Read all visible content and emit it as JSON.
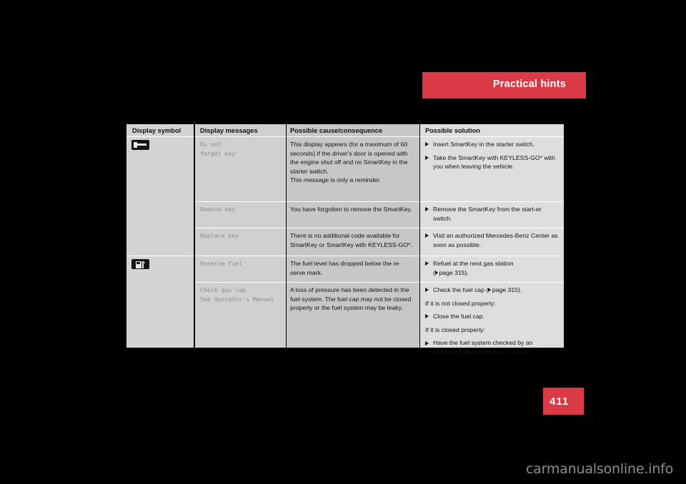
{
  "header": {
    "chapter_title": "Practical hints",
    "accent_color": "#d93a46"
  },
  "page_number": "411",
  "watermark": "carmanualsonline.info",
  "table": {
    "columns": [
      {
        "key": "symbol",
        "header": "Display symbol"
      },
      {
        "key": "messages",
        "header": "Display messages"
      },
      {
        "key": "cause",
        "header": "Possible cause/consequence"
      },
      {
        "key": "solution",
        "header": "Possible solution"
      }
    ],
    "rows": [
      {
        "symbol_icon": "key-in-display-icon",
        "message": "Do not\nforget key",
        "cause": "This display appears (for a maximum of 60 seconds) if the driver's door is opened with the engine shut off and no SmartKey in the starter switch.\nThis message is only a reminder.",
        "solution": [
          {
            "type": "bullet",
            "text": "Insert SmartKey in the starter switch."
          },
          {
            "type": "bullet",
            "text": "Take the SmartKey with KEYLESS-GO* with you when leaving the vehicle."
          }
        ]
      },
      {
        "symbol_icon": "",
        "message": "Remove key",
        "cause": "You have forgotten to remove the SmartKey.",
        "solution": [
          {
            "type": "bullet",
            "text": "Remove the SmartKey from the start-er switch."
          }
        ]
      },
      {
        "symbol_icon": "",
        "message": "Replace key",
        "cause": "There is no additional code available for SmartKey or SmartKey with KEYLESS-GO*.",
        "solution": [
          {
            "type": "bullet",
            "text": "Visit an authorized Mercedes-Benz Center as soon as possible."
          }
        ]
      },
      {
        "symbol_icon": "fuel-pump-icon",
        "message": "Reserve fuel",
        "cause": "The fuel level has dropped below the re-serve mark.",
        "solution": [
          {
            "type": "bullet",
            "text": "Refuel at the next gas station"
          },
          {
            "type": "pageref",
            "text": "page 315)."
          }
        ]
      },
      {
        "symbol_icon": "",
        "message": "Check gas cap\nSee Operator's Manual",
        "cause": "A loss of pressure has been detected in the fuel system. The fuel cap may not be closed properly or the fuel system may be leaky.",
        "solution": [
          {
            "type": "bullet_pageref",
            "text_before": "Check the fuel cap (",
            "text_after": "page 315)."
          },
          {
            "type": "plain",
            "text": "If it is not closed properly:"
          },
          {
            "type": "bullet",
            "text": "Close the fuel cap."
          },
          {
            "type": "plain",
            "text": "If it is closed properly:"
          },
          {
            "type": "bullet",
            "text": "Have the fuel system checked by an authorized Mercedes-Benz Center."
          }
        ]
      }
    ]
  }
}
